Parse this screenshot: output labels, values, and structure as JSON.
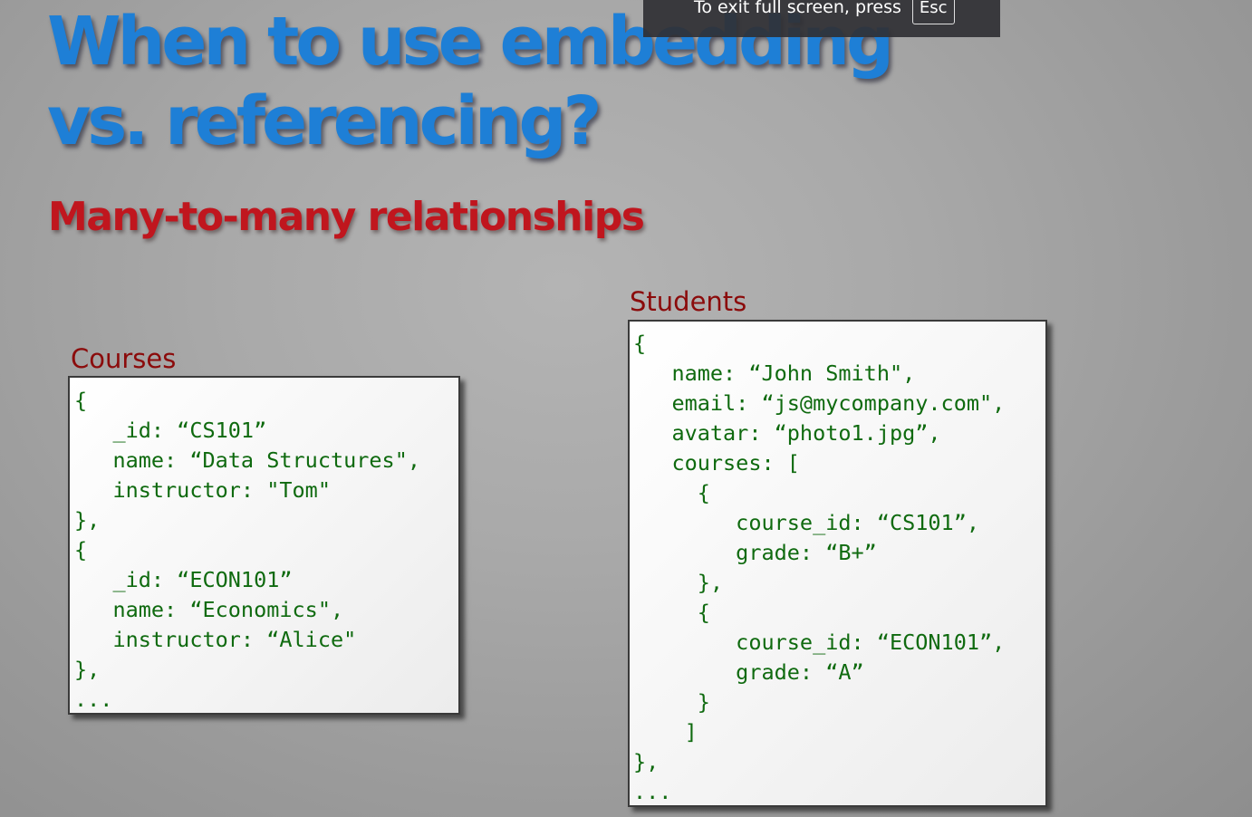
{
  "slide": {
    "title_line1": "When to use embedding",
    "title_line2": "vs. referencing?",
    "subtitle": "Many-to-many relationships",
    "colors": {
      "title": "#1e7fd6",
      "subtitle": "#c0161e",
      "box_label": "#8b0b0b",
      "code": "#0f6a0f"
    }
  },
  "courses": {
    "label": "Courses",
    "lines": [
      "{",
      "   _id: “CS101”",
      "   name: “Data Structures\",",
      "   instructor: \"Tom\"",
      "},",
      "{",
      "   _id: “ECON101”",
      "   name: “Economics\",",
      "   instructor: “Alice\"",
      "},",
      "..."
    ]
  },
  "students": {
    "label": "Students",
    "lines": [
      "{",
      "   name: “John Smith\",",
      "   email: “js@mycompany.com\",",
      "   avatar: “photo1.jpg”,",
      "   courses: [",
      "     {",
      "        course_id: “CS101”,",
      "        grade: “B+”",
      "     },",
      "     {",
      "        course_id: “ECON101”,",
      "        grade: “A”",
      "     }",
      "    ]",
      "},",
      "..."
    ]
  },
  "fullscreen_notice": {
    "text": "To exit full screen, press",
    "key": "Esc"
  }
}
